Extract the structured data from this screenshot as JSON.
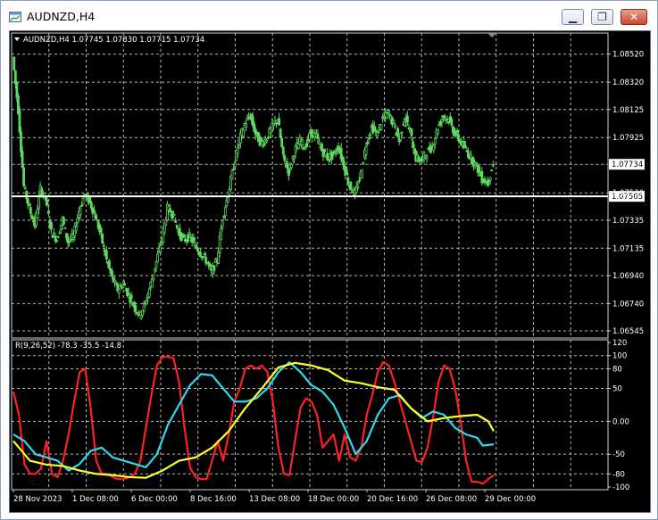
{
  "window": {
    "title": "AUDNZD,H4",
    "buttons": {
      "minimize": "▁",
      "restore": "❐",
      "close": "✕"
    }
  },
  "chart_data": [
    {
      "type": "candlestick",
      "header": "AUDNZD,H4  1.07745 1.07830 1.07715 1.07734",
      "symbol": "AUDNZD",
      "timeframe": "H4",
      "ohlc": {
        "open": 1.07745,
        "high": 1.0783,
        "low": 1.07715,
        "close": 1.07734
      },
      "y_ticks": [
        "1.08520",
        "1.08320",
        "1.08125",
        "1.07925",
        "1.07530",
        "1.07335",
        "1.07135",
        "1.06940",
        "1.06740",
        "1.06545"
      ],
      "ylim": [
        1.06545,
        1.0862
      ],
      "bid_label": "1.07734",
      "bid_value": 1.07734,
      "line_label": "1.07505",
      "line_value": 1.07505,
      "x_ticks": [
        "28 Nov 2023",
        "1 Dec 08:00",
        "6 Dec 00:00",
        "8 Dec 16:00",
        "13 Dec 08:00",
        "18 Dec 00:00",
        "20 Dec 16:00",
        "26 Dec 08:00",
        "29 Dec 00:00"
      ],
      "price_path": [
        [
          0,
          1.085
        ],
        [
          1,
          1.0812
        ],
        [
          2,
          1.0758
        ],
        [
          3,
          1.0742
        ],
        [
          4,
          1.073
        ],
        [
          5,
          1.0756
        ],
        [
          6,
          1.0748
        ],
        [
          7,
          1.0725
        ],
        [
          8,
          1.072
        ],
        [
          9,
          1.0734
        ],
        [
          10,
          1.0718
        ],
        [
          11,
          1.0722
        ],
        [
          12,
          1.074
        ],
        [
          13,
          1.0752
        ],
        [
          14,
          1.0746
        ],
        [
          15,
          1.0736
        ],
        [
          16,
          1.0722
        ],
        [
          17,
          1.0705
        ],
        [
          18,
          1.0692
        ],
        [
          19,
          1.0684
        ],
        [
          20,
          1.0688
        ],
        [
          21,
          1.068
        ],
        [
          22,
          1.0672
        ],
        [
          23,
          1.0666
        ],
        [
          24,
          1.0674
        ],
        [
          25,
          1.0688
        ],
        [
          26,
          1.0704
        ],
        [
          27,
          1.072
        ],
        [
          28,
          1.0742
        ],
        [
          29,
          1.0738
        ],
        [
          30,
          1.0725
        ],
        [
          31,
          1.0719
        ],
        [
          32,
          1.0722
        ],
        [
          33,
          1.0716
        ],
        [
          34,
          1.071
        ],
        [
          35,
          1.0705
        ],
        [
          36,
          1.0696
        ],
        [
          37,
          1.0705
        ],
        [
          38,
          1.0735
        ],
        [
          39,
          1.0752
        ],
        [
          40,
          1.0772
        ],
        [
          41,
          1.079
        ],
        [
          42,
          1.0802
        ],
        [
          43,
          1.0808
        ],
        [
          44,
          1.0795
        ],
        [
          45,
          1.0788
        ],
        [
          46,
          1.0792
        ],
        [
          47,
          1.08
        ],
        [
          48,
          1.0806
        ],
        [
          49,
          1.0778
        ],
        [
          50,
          1.0768
        ],
        [
          51,
          1.0782
        ],
        [
          52,
          1.079
        ],
        [
          53,
          1.0786
        ],
        [
          54,
          1.0796
        ],
        [
          55,
          1.0793
        ],
        [
          56,
          1.0783
        ],
        [
          57,
          1.0778
        ],
        [
          58,
          1.078
        ],
        [
          59,
          1.0786
        ],
        [
          60,
          1.0772
        ],
        [
          61,
          1.0758
        ],
        [
          62,
          1.0752
        ],
        [
          63,
          1.0766
        ],
        [
          64,
          1.0788
        ],
        [
          65,
          1.08
        ],
        [
          66,
          1.0795
        ],
        [
          67,
          1.0806
        ],
        [
          68,
          1.081
        ],
        [
          69,
          1.0802
        ],
        [
          70,
          1.079
        ],
        [
          71,
          1.0808
        ],
        [
          72,
          1.0796
        ],
        [
          73,
          1.0778
        ],
        [
          74,
          1.0776
        ],
        [
          75,
          1.0782
        ],
        [
          76,
          1.0786
        ],
        [
          77,
          1.08
        ],
        [
          78,
          1.0808
        ],
        [
          79,
          1.0805
        ],
        [
          80,
          1.0796
        ],
        [
          81,
          1.079
        ],
        [
          82,
          1.0784
        ],
        [
          83,
          1.0778
        ],
        [
          84,
          1.0772
        ],
        [
          85,
          1.0763
        ],
        [
          86,
          1.076
        ],
        [
          87,
          1.0773
        ]
      ]
    },
    {
      "type": "line",
      "label": "R(9,26,52) -78.3 -35.5 -14.8",
      "y_ticks": [
        "120",
        "100",
        "80",
        "50",
        "0.00",
        "-50",
        "-80",
        "-100"
      ],
      "y_tick_values": [
        120,
        100,
        80,
        50,
        0,
        -50,
        -80,
        -100
      ],
      "ylim": [
        -100,
        120
      ],
      "series": [
        {
          "color": "#ff2020",
          "values": [
            [
              0,
              45
            ],
            [
              1,
              10
            ],
            [
              2,
              -65
            ],
            [
              3,
              -80
            ],
            [
              4,
              -80
            ],
            [
              5,
              -72
            ],
            [
              6,
              -30
            ],
            [
              7,
              -80
            ],
            [
              8,
              -85
            ],
            [
              9,
              -60
            ],
            [
              10,
              -20
            ],
            [
              11,
              30
            ],
            [
              12,
              75
            ],
            [
              13,
              80
            ],
            [
              14,
              20
            ],
            [
              15,
              -60
            ],
            [
              16,
              -80
            ],
            [
              17,
              -80
            ],
            [
              18,
              -85
            ],
            [
              19,
              -88
            ],
            [
              20,
              -88
            ],
            [
              21,
              -85
            ],
            [
              22,
              -80
            ],
            [
              23,
              -60
            ],
            [
              24,
              -10
            ],
            [
              25,
              40
            ],
            [
              26,
              85
            ],
            [
              27,
              98
            ],
            [
              28,
              98
            ],
            [
              29,
              96
            ],
            [
              30,
              60
            ],
            [
              31,
              -10
            ],
            [
              32,
              -70
            ],
            [
              33,
              -85
            ],
            [
              34,
              -88
            ],
            [
              35,
              -88
            ],
            [
              36,
              -60
            ],
            [
              37,
              -30
            ],
            [
              38,
              -60
            ],
            [
              39,
              -20
            ],
            [
              40,
              30
            ],
            [
              41,
              50
            ],
            [
              42,
              80
            ],
            [
              43,
              85
            ],
            [
              44,
              80
            ],
            [
              45,
              85
            ],
            [
              46,
              75
            ],
            [
              47,
              30
            ],
            [
              48,
              -40
            ],
            [
              49,
              -80
            ],
            [
              50,
              -82
            ],
            [
              51,
              -30
            ],
            [
              52,
              20
            ],
            [
              53,
              35
            ],
            [
              54,
              30
            ],
            [
              55,
              10
            ],
            [
              56,
              -40
            ],
            [
              57,
              -30
            ],
            [
              58,
              -20
            ],
            [
              59,
              -60
            ],
            [
              60,
              -20
            ],
            [
              61,
              -55
            ],
            [
              62,
              -60
            ],
            [
              63,
              -40
            ],
            [
              64,
              10
            ],
            [
              65,
              40
            ],
            [
              66,
              75
            ],
            [
              67,
              90
            ],
            [
              68,
              85
            ],
            [
              69,
              60
            ],
            [
              70,
              30
            ],
            [
              71,
              0
            ],
            [
              72,
              -30
            ],
            [
              73,
              -60
            ],
            [
              74,
              -62
            ],
            [
              75,
              -40
            ],
            [
              76,
              5
            ],
            [
              77,
              60
            ],
            [
              78,
              85
            ],
            [
              79,
              80
            ],
            [
              80,
              50
            ],
            [
              81,
              0
            ],
            [
              82,
              -60
            ],
            [
              83,
              -92
            ],
            [
              84,
              -92
            ],
            [
              85,
              -95
            ],
            [
              86,
              -88
            ],
            [
              87,
              -82
            ]
          ]
        },
        {
          "color": "#30d8f0",
          "values": [
            [
              0,
              -20
            ],
            [
              2,
              -30
            ],
            [
              4,
              -50
            ],
            [
              6,
              -55
            ],
            [
              8,
              -60
            ],
            [
              10,
              -75
            ],
            [
              12,
              -65
            ],
            [
              14,
              -45
            ],
            [
              16,
              -40
            ],
            [
              18,
              -55
            ],
            [
              20,
              -60
            ],
            [
              22,
              -65
            ],
            [
              24,
              -70
            ],
            [
              26,
              -50
            ],
            [
              28,
              -5
            ],
            [
              30,
              25
            ],
            [
              32,
              55
            ],
            [
              34,
              72
            ],
            [
              36,
              70
            ],
            [
              38,
              50
            ],
            [
              40,
              30
            ],
            [
              42,
              30
            ],
            [
              44,
              35
            ],
            [
              46,
              50
            ],
            [
              48,
              75
            ],
            [
              50,
              90
            ],
            [
              52,
              75
            ],
            [
              54,
              55
            ],
            [
              56,
              45
            ],
            [
              58,
              25
            ],
            [
              60,
              -10
            ],
            [
              62,
              -50
            ],
            [
              64,
              -30
            ],
            [
              66,
              10
            ],
            [
              68,
              35
            ],
            [
              70,
              40
            ],
            [
              72,
              20
            ],
            [
              74,
              5
            ],
            [
              76,
              15
            ],
            [
              78,
              10
            ],
            [
              80,
              -10
            ],
            [
              82,
              -20
            ],
            [
              84,
              -25
            ],
            [
              85,
              -37
            ],
            [
              87,
              -35
            ]
          ]
        },
        {
          "color": "#ffff33",
          "values": [
            [
              0,
              -30
            ],
            [
              3,
              -60
            ],
            [
              6,
              -66
            ],
            [
              9,
              -68
            ],
            [
              12,
              -75
            ],
            [
              15,
              -80
            ],
            [
              18,
              -82
            ],
            [
              21,
              -85
            ],
            [
              24,
              -86
            ],
            [
              27,
              -75
            ],
            [
              30,
              -60
            ],
            [
              33,
              -55
            ],
            [
              36,
              -40
            ],
            [
              39,
              -15
            ],
            [
              42,
              20
            ],
            [
              45,
              50
            ],
            [
              48,
              82
            ],
            [
              51,
              89
            ],
            [
              54,
              85
            ],
            [
              57,
              78
            ],
            [
              60,
              62
            ],
            [
              63,
              58
            ],
            [
              66,
              52
            ],
            [
              69,
              48
            ],
            [
              72,
              20
            ],
            [
              75,
              0
            ],
            [
              78,
              5
            ],
            [
              81,
              8
            ],
            [
              84,
              10
            ],
            [
              86,
              0
            ],
            [
              87,
              -15
            ]
          ]
        }
      ]
    }
  ]
}
